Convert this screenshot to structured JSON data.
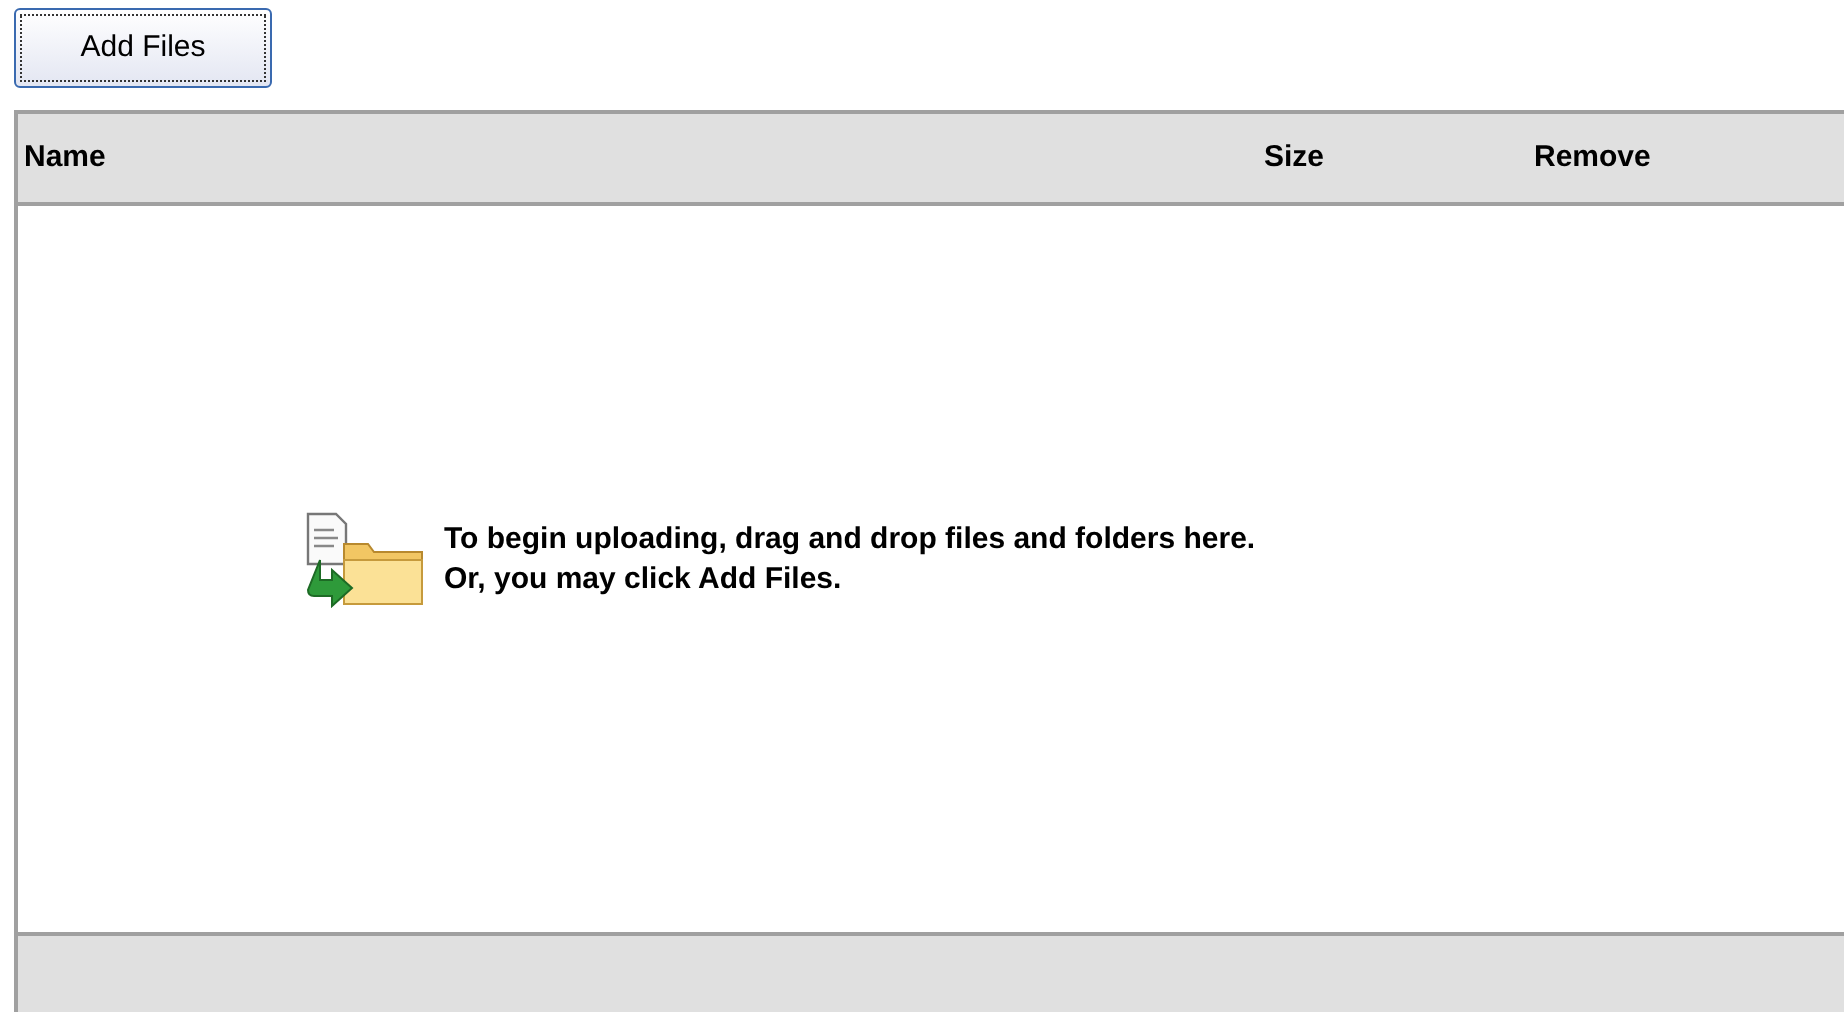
{
  "toolbar": {
    "add_button": "Add Files"
  },
  "table": {
    "columns": [
      "Name",
      "Size",
      "Remove"
    ]
  },
  "empty_message": {
    "lines": [
      "To begin uploading, drag and drop files and folders here.",
      "Or, you may click Add Files."
    ]
  }
}
